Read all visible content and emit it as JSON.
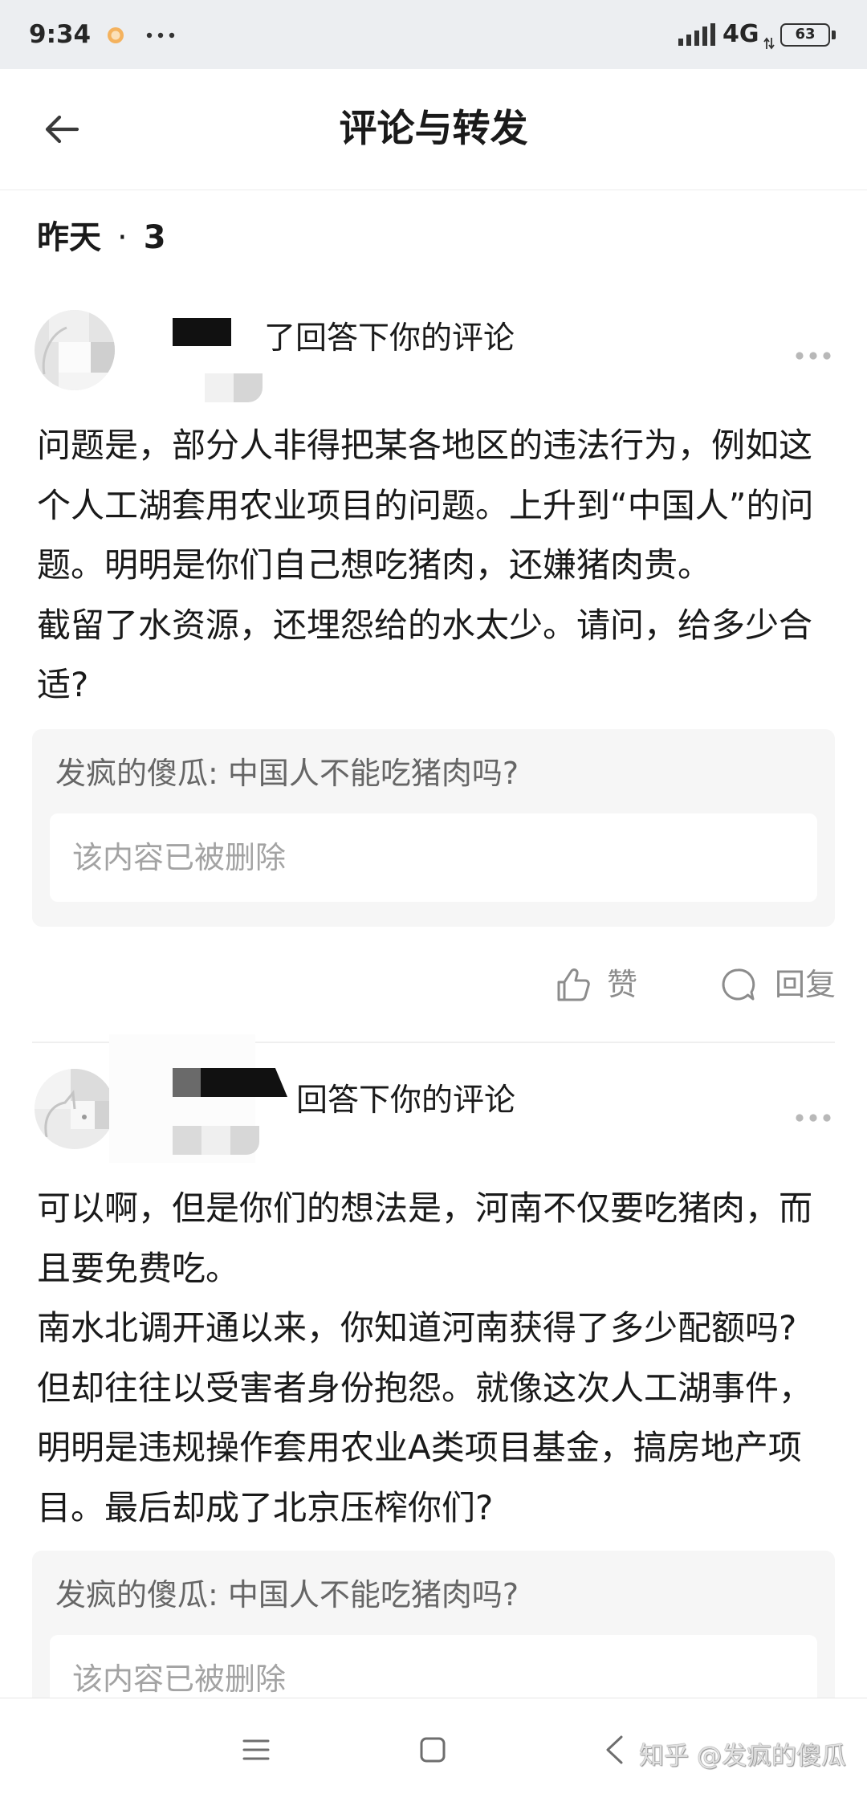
{
  "status_bar": {
    "time": "9:34",
    "network_type": "4G",
    "battery_level": "63",
    "icons": {
      "notification": "app-notification-icon",
      "overflow": "more-notifications-icon",
      "signal": "signal-icon",
      "data_activity": "data-activity-icon",
      "battery": "battery-icon"
    }
  },
  "header": {
    "title": "评论与转发",
    "back_icon": "back-arrow-icon"
  },
  "section": {
    "day": "昨天",
    "separator": "·",
    "count": "3"
  },
  "comments": [
    {
      "action_text": "了回答下你的评论",
      "more_icon": "more-dots-icon",
      "body_lines": [
        "问题是，部分人非得把某各地区的违法行为，例如这",
        "个人工湖套用农业项目的问题。上升到“中国人”的问",
        "题。明明是你们自己想吃猪肉，还嫌猪肉贵。",
        "截留了水资源，还埋怨给的水太少。请问，给多少合",
        "适?"
      ],
      "quote": {
        "author": "发疯的傻瓜:",
        "text": "中国人不能吃猪肉吗?",
        "deleted_notice": "该内容已被删除"
      },
      "actions": {
        "like_label": "赞",
        "like_icon": "thumbs-up-icon",
        "reply_label": "回复",
        "reply_icon": "comment-bubble-icon"
      }
    },
    {
      "action_text": "回答下你的评论",
      "more_icon": "more-dots-icon",
      "body_lines": [
        "可以啊，但是你们的想法是，河南不仅要吃猪肉，而",
        "且要免费吃。",
        "南水北调开通以来，你知道河南获得了多少配额吗?",
        "但却往往以受害者身份抱怨。就像这次人工湖事件，",
        "明明是违规操作套用农业A类项目基金，搞房地产项",
        "目。最后却成了北京压榨你们?"
      ],
      "quote": {
        "author": "发疯的傻瓜:",
        "text": "中国人不能吃猪肉吗?",
        "deleted_notice": "该内容已被删除"
      }
    }
  ],
  "bottom_nav": {
    "icons": [
      "menu-icon",
      "home-icon",
      "back-icon"
    ]
  },
  "watermark": "知乎 @发疯的傻瓜",
  "colors": {
    "status_bar_bg": "#eceef1",
    "text_primary": "#1a1a1a",
    "text_secondary": "#8c8c8c",
    "quote_bg": "#f6f6f6",
    "quote_text": "#666666",
    "deleted_text": "#a3a3a3"
  }
}
